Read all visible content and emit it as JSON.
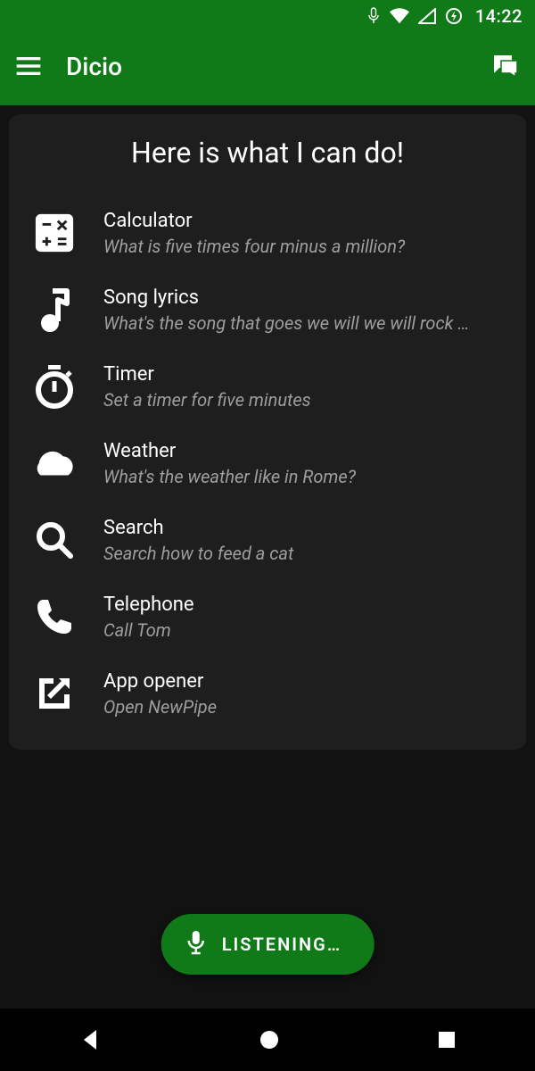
{
  "statusbar": {
    "time": "14:22"
  },
  "appbar": {
    "title": "Dicio"
  },
  "card": {
    "heading": "Here is what I can do!"
  },
  "skills": [
    {
      "title": "Calculator",
      "subtitle": "What is five times four minus a million?"
    },
    {
      "title": "Song lyrics",
      "subtitle": "What's the song that goes we will we will rock …"
    },
    {
      "title": "Timer",
      "subtitle": "Set a timer for five minutes"
    },
    {
      "title": "Weather",
      "subtitle": "What's the weather like in Rome?"
    },
    {
      "title": "Search",
      "subtitle": "Search how to feed a cat"
    },
    {
      "title": "Telephone",
      "subtitle": "Call Tom"
    },
    {
      "title": "App opener",
      "subtitle": "Open NewPipe"
    }
  ],
  "listen": {
    "label": "LISTENING…"
  }
}
